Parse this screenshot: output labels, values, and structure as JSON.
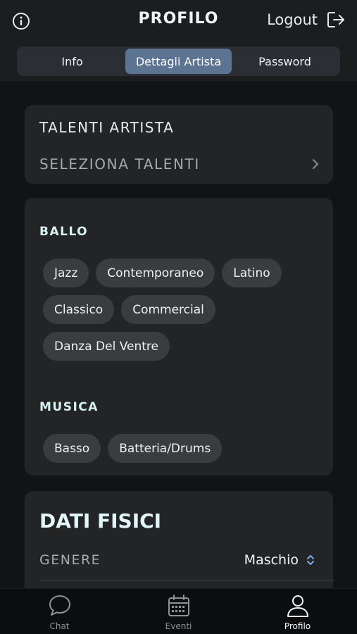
{
  "header": {
    "title": "PROFILO",
    "logout_label": "Logout",
    "info_icon": "info-circle-icon",
    "logout_icon": "logout-arrow-icon"
  },
  "tabs": [
    {
      "label": "Info",
      "active": false
    },
    {
      "label": "Dettagli Artista",
      "active": true
    },
    {
      "label": "Password",
      "active": false
    }
  ],
  "talenti": {
    "title": "TALENTI ARTISTA",
    "select_label": "SELEZIONA TALENTI"
  },
  "categories": [
    {
      "title": "BALLO",
      "chips": [
        "Jazz",
        "Contemporaneo",
        "Latino",
        "Classico",
        "Commercial",
        "Danza Del Ventre"
      ]
    },
    {
      "title": "MUSICA",
      "chips": [
        "Basso",
        "Batteria/Drums"
      ]
    }
  ],
  "dati_fisici": {
    "title": "DATI FISICI",
    "genere_label": "GENERE",
    "genere_value": "Maschio"
  },
  "tabbar": [
    {
      "label": "Chat",
      "icon": "chat-bubble-icon",
      "active": false
    },
    {
      "label": "Eventi",
      "icon": "calendar-icon",
      "active": false
    },
    {
      "label": "Profilo",
      "icon": "user-icon",
      "active": true
    }
  ],
  "colors": {
    "accent": "#5c7491",
    "background": "#121314",
    "card": "#222426",
    "chip": "#3a3d40"
  }
}
